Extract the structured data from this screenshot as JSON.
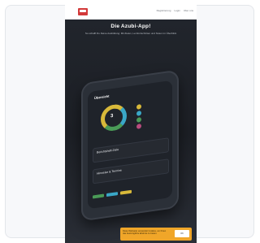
{
  "site": {
    "nav": [
      "Registrierung",
      "Login",
      "Uber uns"
    ],
    "headline": "Die Azubi-App!",
    "subline": "So schafft Du Deine Ausbildung: Mit Zielen, Lernfortschritten und Noten im Überblick"
  },
  "app": {
    "title": "Übersicht",
    "score": "3",
    "panel1": "Berichtsheft-Ziele",
    "panel2": "Hinweise & Termine"
  },
  "cookie": {
    "text": "Diese Webseite verwendet Cookies, um Ihnen das bestmögliche Erlebnis zu bieten.",
    "button": "OK"
  },
  "colors": {
    "accent": "#d33a3a",
    "yellow": "#d8b93a",
    "blue": "#3aa7c7",
    "green": "#4a9b57",
    "cookie": "#f0a629"
  }
}
